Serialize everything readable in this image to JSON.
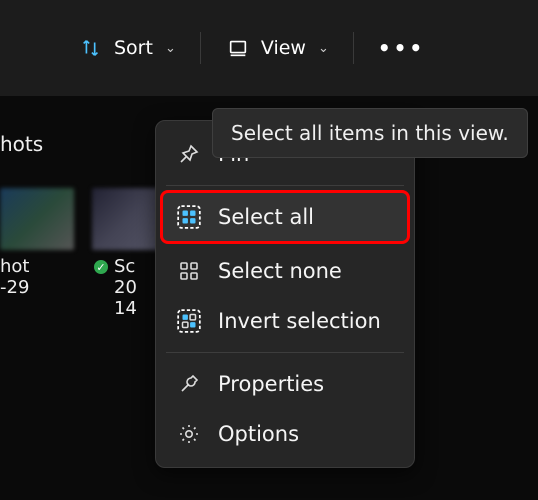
{
  "toolbar": {
    "sort_label": "Sort",
    "view_label": "View",
    "more_label": "•••"
  },
  "group_title": "hots",
  "thumbs": [
    {
      "name": "hot",
      "sub": "-29"
    },
    {
      "name": "Sc",
      "sub": "20",
      "sub2": "14"
    }
  ],
  "tooltip": "Select all items in this view.",
  "menu": {
    "pin": "Pin",
    "select_all": "Select all",
    "select_none": "Select none",
    "invert_selection": "Invert selection",
    "properties": "Properties",
    "options": "Options"
  },
  "colors": {
    "accent": "#4cc2ff"
  }
}
